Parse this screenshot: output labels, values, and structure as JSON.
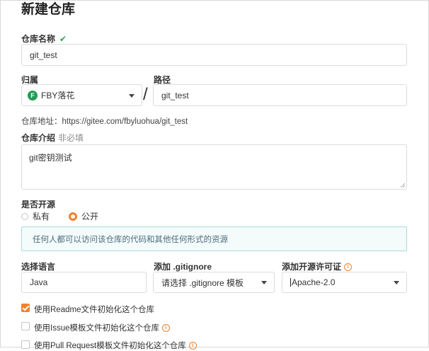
{
  "page": {
    "title": "新建仓库"
  },
  "repo_name": {
    "label": "仓库名称",
    "value": "git_test"
  },
  "owner": {
    "label": "归属",
    "avatar_letter": "F",
    "value": "FBY落花"
  },
  "separator": "/",
  "path": {
    "label": "路径",
    "value": "git_test"
  },
  "repo_address": {
    "text": "仓库地址：https://gitee.com/fbyluohua/git_test"
  },
  "description": {
    "label": "仓库介绍",
    "hint": "非必填",
    "value": "git密钥测试"
  },
  "visibility": {
    "label": "是否开源",
    "options": [
      {
        "label": "私有",
        "selected": false
      },
      {
        "label": "公开",
        "selected": true
      }
    ],
    "notice": "任何人都可以访问该仓库的代码和其他任何形式的资源"
  },
  "language": {
    "label": "选择语言",
    "value": "Java"
  },
  "gitignore": {
    "label": "添加 .gitignore",
    "value": "请选择 .gitignore 模板"
  },
  "license": {
    "label": "添加开源许可证",
    "value": "Apache-2.0"
  },
  "init_options": [
    {
      "label": "使用Readme文件初始化这个仓库",
      "checked": true
    },
    {
      "label": "使用Issue模板文件初始化这个仓库",
      "checked": false
    },
    {
      "label": "使用Pull Request模板文件初始化这个仓库",
      "checked": false
    }
  ],
  "colors": {
    "accent": "#f1812d",
    "success": "#2ea44f",
    "notice_border": "#a8dcd7"
  }
}
